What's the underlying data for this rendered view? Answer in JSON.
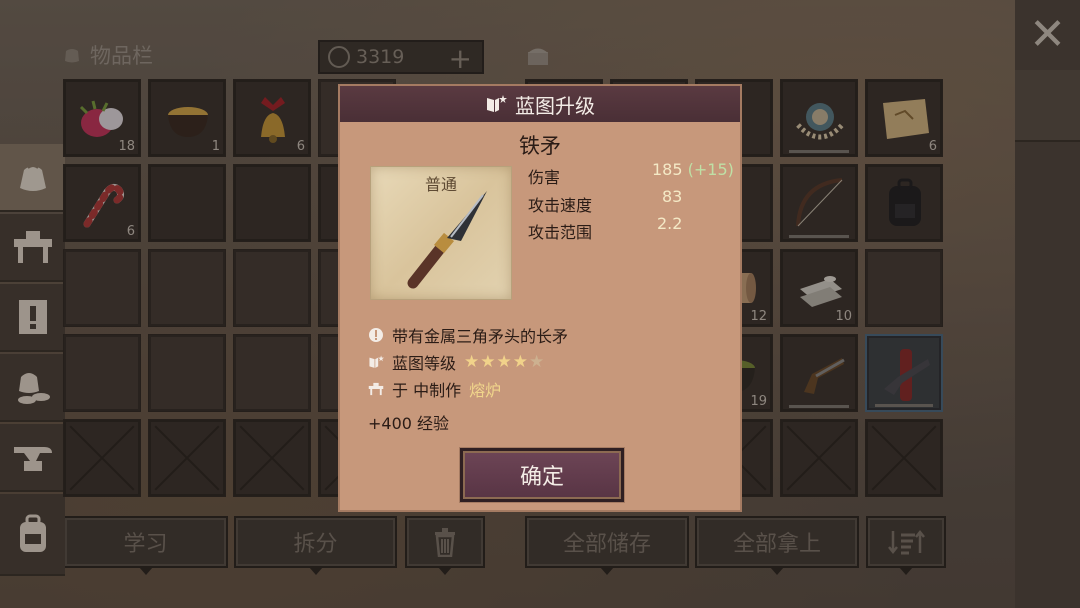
{
  "inventory": {
    "title": "物品栏",
    "currency": "3319",
    "add_label": "+",
    "slots": [
      {
        "item": "dragon-fruit",
        "count": "18"
      },
      {
        "item": "bowl",
        "count": "1"
      },
      {
        "item": "bell",
        "count": "6"
      },
      {
        "item": "necklace",
        "count": ""
      },
      {
        "item": "map",
        "count": "6"
      },
      {
        "item": "candy-cane",
        "count": "6"
      },
      {
        "item": "bow",
        "count": ""
      },
      {
        "item": "backpack",
        "count": ""
      },
      {
        "item": "scroll",
        "count": "12"
      },
      {
        "item": "cloth",
        "count": "10"
      },
      {
        "item": "pot",
        "count": "19"
      },
      {
        "item": "pistol",
        "count": ""
      },
      {
        "item": "rifle",
        "count": ""
      }
    ]
  },
  "buttons": {
    "learn": "学习",
    "split": "拆分",
    "store_all": "全部储存",
    "take_all": "全部拿上"
  },
  "modal": {
    "title": "蓝图升级",
    "item_name": "铁矛",
    "rarity": "普通",
    "stats": [
      {
        "label": "伤害",
        "value": "185",
        "bonus": "(+15)"
      },
      {
        "label": "攻击速度",
        "value": "83",
        "bonus": ""
      },
      {
        "label": "攻击范围",
        "value": "2.2",
        "bonus": ""
      }
    ],
    "description": "带有金属三角矛头的长矛",
    "blueprint_level_label": "蓝图等级",
    "blueprint_stars": 4,
    "blueprint_stars_max": 5,
    "craft_label": "于 中制作",
    "craft_station": "熔炉",
    "xp": "+400 经验",
    "confirm": "确定"
  },
  "sidebar": {
    "items": [
      "close-icon",
      "bag-icon",
      "workbench-icon",
      "quest-icon",
      "resources-icon",
      "anvil-icon",
      "backpack-icon"
    ]
  }
}
